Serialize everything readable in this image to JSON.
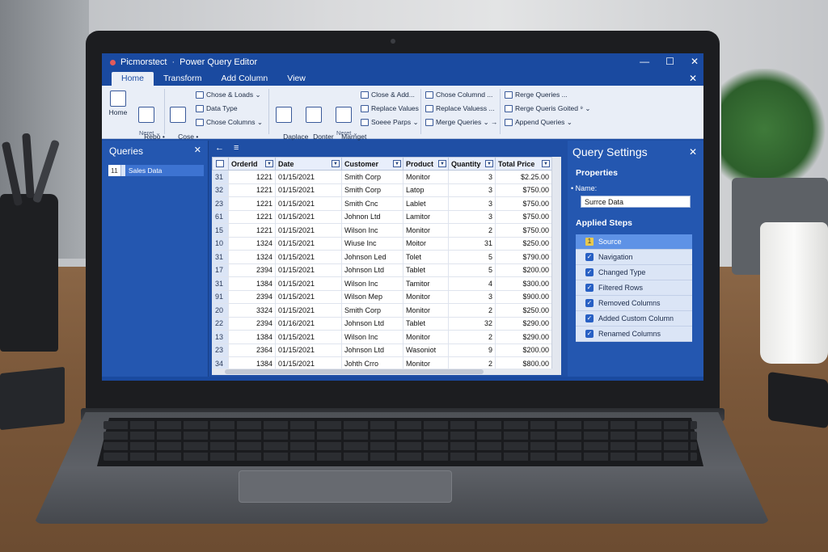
{
  "app": {
    "title_left": "Picmorstect",
    "title_right": "Power Query Editor",
    "window_controls": [
      "—",
      "☐",
      "✕"
    ]
  },
  "tabs": [
    "Home",
    "Transform",
    "Add Column",
    "View"
  ],
  "ribbon": {
    "big_buttons": [
      {
        "label": "Home"
      },
      {
        "label": "Rebo •\nQueries •"
      },
      {
        "label": "Cose •\nLoad"
      },
      {
        "label": "Daplace\nValues"
      },
      {
        "label": "Donter\nVicce"
      },
      {
        "label": "Marnget\nQueries"
      }
    ],
    "small_buttons": [
      "Chose & Loads ⌄",
      "Data Type",
      "Chose Columns ⌄",
      "Close & Add...",
      "Replace Values",
      "Soeee Parps ⌄",
      "Chose Columnd ...",
      "Replace Valuess ...",
      "Merge Queries ⌄ →",
      "Rerge Queries ...",
      "Rerge Queris Goited ⁹ ⌄",
      "Append Queries ⌄"
    ],
    "group_labels": [
      "Neret ⌄",
      "Neret ⌄"
    ]
  },
  "queries_pane": {
    "title": "Queries",
    "item_number": "11",
    "item_label": "Sales Data"
  },
  "grid": {
    "columns": [
      "OrderId",
      "Date",
      "Customer",
      "Product",
      "Quantity",
      "Total Price"
    ],
    "rows": [
      [
        "31",
        "1221",
        "01/15/2021",
        "Smith Corp",
        "Monitor",
        "3",
        "$2.25.00"
      ],
      [
        "32",
        "1221",
        "01/15/2021",
        "Smith Corp",
        "Latop",
        "3",
        "$750.00"
      ],
      [
        "23",
        "1221",
        "01/15/2021",
        "Smith Cnc",
        "Lablet",
        "3",
        "$750.00"
      ],
      [
        "61",
        "1221",
        "01/15/2021",
        "Johnon Ltd",
        "Lamitor",
        "3",
        "$750.00"
      ],
      [
        "15",
        "1221",
        "01/15/2021",
        "Wilson Inc",
        "Monitor",
        "2",
        "$750.00"
      ],
      [
        "10",
        "1324",
        "01/15/2021",
        "Wiuse Inc",
        "Moitor",
        "31",
        "$250.00"
      ],
      [
        "31",
        "1324",
        "01/15/2021",
        "Johnson Led",
        "Tolet",
        "5",
        "$790.00"
      ],
      [
        "17",
        "2394",
        "01/15/2021",
        "Johnson Ltd",
        "Tablet",
        "5",
        "$200.00"
      ],
      [
        "31",
        "1384",
        "01/15/2021",
        "Wilson Inc",
        "Tamitor",
        "4",
        "$300.00"
      ],
      [
        "91",
        "2394",
        "01/15/2021",
        "Wilson Mep",
        "Monitor",
        "3",
        "$900.00"
      ],
      [
        "20",
        "3324",
        "01/15/2021",
        "Smith Corp",
        "Monitor",
        "2",
        "$250.00"
      ],
      [
        "22",
        "2394",
        "01/16/2021",
        "Johnson Ltd",
        "Tablet",
        "32",
        "$290.00"
      ],
      [
        "13",
        "1384",
        "01/15/2021",
        "Wilson Inc",
        "Monitor",
        "2",
        "$290.00"
      ],
      [
        "23",
        "2364",
        "01/15/2021",
        "Johnson Ltd",
        "Wasoniot",
        "9",
        "$200.00"
      ],
      [
        "34",
        "1384",
        "01/15/2021",
        "Johth Crro",
        "Monitor",
        "2",
        "$800.00"
      ]
    ]
  },
  "settings": {
    "title": "Query Settings",
    "properties_header": "Properties",
    "name_label": "• Name:",
    "name_value": "Surrce Data",
    "steps_header": "Applied Steps",
    "steps": [
      "Source",
      "Navigation",
      "Changed Type",
      "Filtered Rows",
      "Removed Columns",
      "Added Custom Column",
      "Renamed Columns"
    ]
  },
  "colors": {
    "accent": "#1f4fa5",
    "ribbon_bg": "#e9eef7",
    "pane_bg": "#2457b0"
  }
}
